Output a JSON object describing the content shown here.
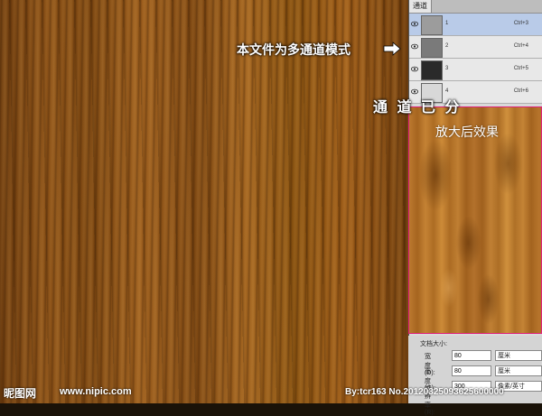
{
  "annotations": {
    "multichannel_note": "本文件为多通道模式",
    "channels_split": "通 道 已 分",
    "zoom_effect": "放大后效果"
  },
  "channels_panel": {
    "tab_label": "通道",
    "rows": [
      {
        "name": "1",
        "shortcut": "Ctrl+3",
        "selected": true
      },
      {
        "name": "2",
        "shortcut": "Ctrl+4",
        "selected": false
      },
      {
        "name": "3",
        "shortcut": "Ctrl+5",
        "selected": false
      },
      {
        "name": "4",
        "shortcut": "Ctrl+6",
        "selected": false
      }
    ]
  },
  "document_size": {
    "title": "文档大小:",
    "width": {
      "label": "宽度(D):",
      "value": "80",
      "unit": "厘米"
    },
    "height": {
      "label": "高度(G):",
      "value": "80",
      "unit": "厘米"
    },
    "resolution": {
      "label": "分辨率(R):",
      "value": "300",
      "unit": "像素/英寸"
    }
  },
  "watermark": {
    "logo": "昵图网",
    "url": "www.nipic.com",
    "author": "By:tcr163  No.20120325093625600000"
  },
  "colors": {
    "zoom_border": "#e0207a",
    "selected_row": "#b9cbe8"
  }
}
